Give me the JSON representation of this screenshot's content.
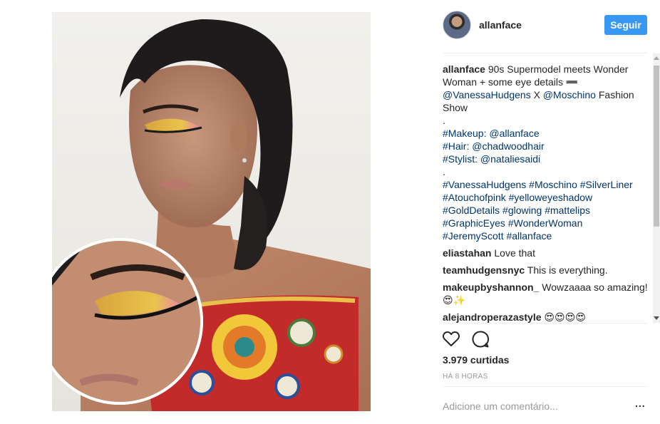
{
  "post": {
    "username": "allanface",
    "follow_label": "Seguir",
    "caption": {
      "username": "allanface",
      "text": "90s Supermodel meets Wonder Woman + some eye details ➖",
      "mention1": "@VanessaHudgens",
      "x": "X",
      "mention2": "@Moschino",
      "rest": "Fashion Show",
      "dot1": ".",
      "credit_makeup_tag": "#Makeup:",
      "credit_makeup_user": "@allanface",
      "credit_hair_tag": "#Hair:",
      "credit_hair_user": "@chadwoodhair",
      "credit_stylist_tag": "#Stylist:",
      "credit_stylist_user": "@nataliesaidi",
      "dot2": ".",
      "hashtags": [
        "#VanessaHudgens #Moschino #SilverLiner",
        "#Atouchofpink #yelloweyeshadow",
        "#GoldDetails #glowing #mattelips",
        "#GraphicEyes #WonderWoman",
        "#JeremyScott #allanface"
      ]
    },
    "comments": [
      {
        "user": "eliastahan",
        "text": "Love that"
      },
      {
        "user": "teamhudgensnyc",
        "text": "This is everything."
      },
      {
        "user": "makeupbyshannon_",
        "text": "Wowzaaaa so amazing!😍✨"
      },
      {
        "user": "alejandroperazastyle",
        "text": "😍😍😍😍"
      }
    ],
    "likes": "3.979 curtidas",
    "timestamp": "HÁ 8 HORAS",
    "comment_placeholder": "Adicione um comentário...",
    "more_label": "..."
  },
  "icons": {
    "like": "heart-outline-icon",
    "comment": "speech-bubble-icon",
    "options": "ellipsis-icon"
  },
  "colors": {
    "follow_button": "#3897f0",
    "link": "#003569",
    "muted": "#999999"
  }
}
